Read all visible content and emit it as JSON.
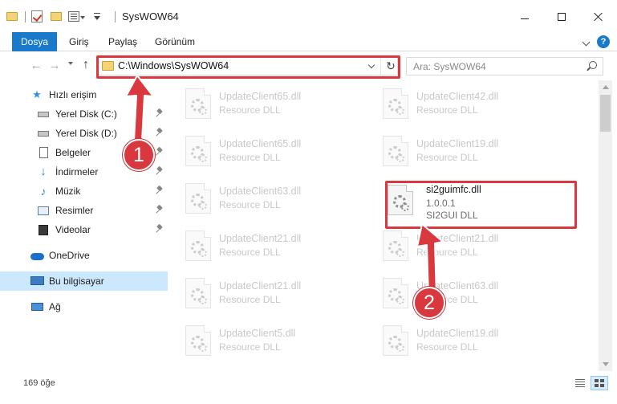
{
  "window": {
    "title": "SysWOW64"
  },
  "ribbon": {
    "tabs": [
      {
        "label": "Dosya"
      },
      {
        "label": "Giriş"
      },
      {
        "label": "Paylaş"
      },
      {
        "label": "Görünüm"
      }
    ],
    "help_label": "?"
  },
  "address": {
    "path": "C:\\Windows\\SysWOW64",
    "search_placeholder": "Ara: SysWOW64"
  },
  "sidebar": {
    "items": [
      {
        "label": "Hızlı erişim",
        "icon": "star-icon",
        "pinned": false
      },
      {
        "label": "Yerel Disk (C:)",
        "icon": "drive-icon",
        "pinned": true
      },
      {
        "label": "Yerel Disk (D:)",
        "icon": "drive-icon",
        "pinned": true
      },
      {
        "label": "Belgeler",
        "icon": "documents-icon",
        "pinned": true
      },
      {
        "label": "İndirmeler",
        "icon": "download-icon",
        "pinned": true
      },
      {
        "label": "Müzik",
        "icon": "music-icon",
        "pinned": true
      },
      {
        "label": "Resimler",
        "icon": "pictures-icon",
        "pinned": true
      },
      {
        "label": "Videolar",
        "icon": "videos-icon",
        "pinned": true
      },
      {
        "label": "OneDrive",
        "icon": "cloud-icon",
        "pinned": false
      },
      {
        "label": "Bu bilgisayar",
        "icon": "computer-icon",
        "pinned": false,
        "selected": true
      },
      {
        "label": "Ağ",
        "icon": "network-icon",
        "pinned": false
      }
    ]
  },
  "files": {
    "left_column": [
      {
        "name": "UpdateClient65.dll",
        "type": "Resource DLL"
      },
      {
        "name": "UpdateClient65.dll",
        "type": "Resource DLL"
      },
      {
        "name": "UpdateClient63.dll",
        "type": "Resource DLL"
      },
      {
        "name": "UpdateClient21.dll",
        "type": "Resource DLL"
      },
      {
        "name": "UpdateClient21.dll",
        "type": "Resource DLL"
      },
      {
        "name": "UpdateClient5.dll",
        "type": "Resource DLL"
      }
    ],
    "right_column": [
      {
        "name": "UpdateClient42.dll",
        "type": "Resource DLL"
      },
      {
        "name": "UpdateClient19.dll",
        "type": "Resource DLL"
      },
      {
        "name": "si2guimfc.dll",
        "version": "1.0.0.1",
        "type": "SI2GUI DLL",
        "highlighted": true
      },
      {
        "name": "UpdateClient21.dll",
        "type": "Resource DLL"
      },
      {
        "name": "UpdateClient63.dll",
        "type": "Resource DLL"
      },
      {
        "name": "UpdateClient19.dll",
        "type": "Resource DLL"
      }
    ]
  },
  "status": {
    "item_count": "169 öğe"
  },
  "annotations": {
    "step1": "1",
    "step2": "2",
    "color": "#d9383e"
  }
}
